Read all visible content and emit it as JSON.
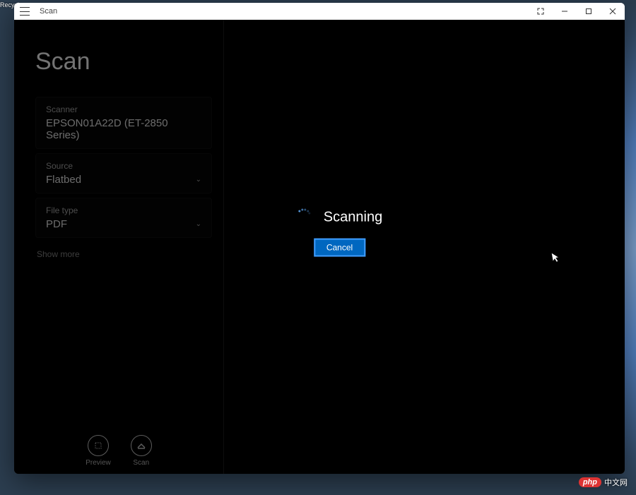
{
  "desktop": {
    "recycle_label": "Recycle"
  },
  "titlebar": {
    "title": "Scan"
  },
  "sidebar": {
    "page_title": "Scan",
    "scanner": {
      "label": "Scanner",
      "value": "EPSON01A22D (ET-2850 Series)"
    },
    "source": {
      "label": "Source",
      "value": "Flatbed"
    },
    "filetype": {
      "label": "File type",
      "value": "PDF"
    },
    "show_more": "Show more",
    "footer": {
      "preview": "Preview",
      "scan": "Scan"
    }
  },
  "progress": {
    "status": "Scanning",
    "cancel": "Cancel"
  },
  "watermark": {
    "badge": "php",
    "text": "中文网"
  }
}
